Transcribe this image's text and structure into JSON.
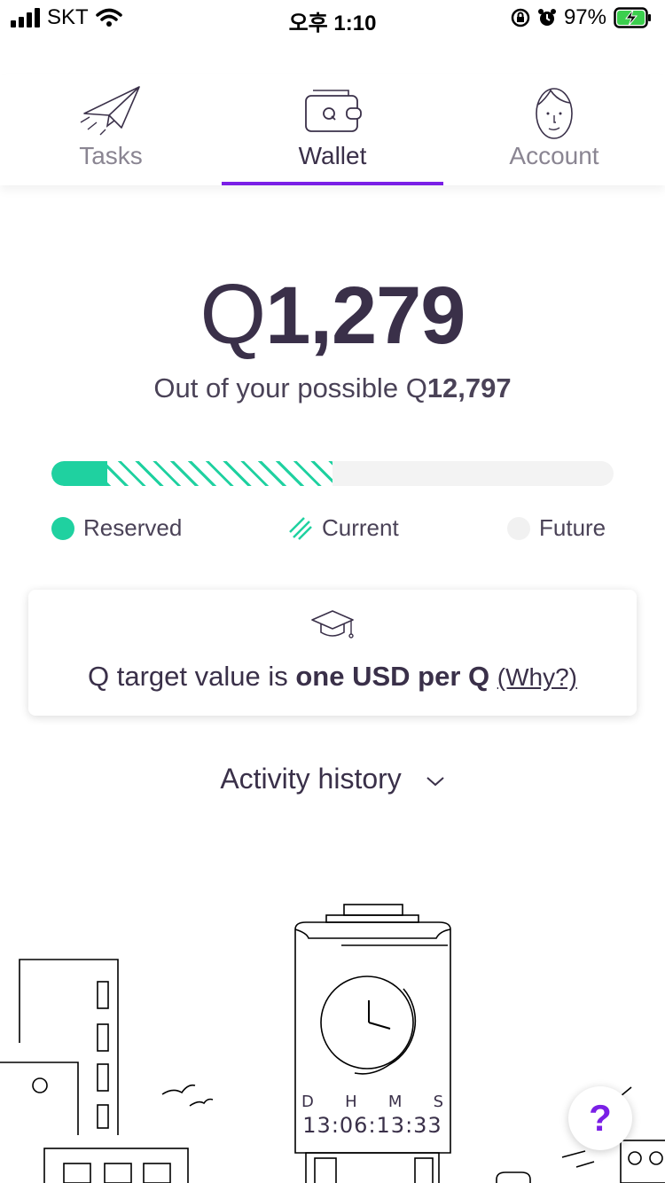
{
  "status": {
    "carrier": "SKT",
    "time": "오후 1:10",
    "battery": "97%"
  },
  "tabs": [
    {
      "label": "Tasks",
      "icon": "paper-plane-icon",
      "active": false
    },
    {
      "label": "Wallet",
      "icon": "wallet-icon",
      "active": true
    },
    {
      "label": "Account",
      "icon": "face-icon",
      "active": false
    }
  ],
  "balance": {
    "symbol": "Q",
    "amount": "1,279",
    "possible_prefix": "Out of your possible",
    "possible_symbol": "Q",
    "possible_amount": "12,797"
  },
  "progress": {
    "reserved_fraction": 0.1,
    "current_fraction": 0.5
  },
  "legend": {
    "reserved": "Reserved",
    "current": "Current",
    "future": "Future"
  },
  "colors": {
    "accent": "#7a1fe6",
    "reserved": "#1fd1a0",
    "text": "#3a3049"
  },
  "info_card": {
    "prefix": "Q target value is ",
    "bold": "one USD per Q",
    "link": "(Why?)",
    "icon": "graduation-cap-icon"
  },
  "activity": {
    "label": "Activity history"
  },
  "timer": {
    "labels": [
      "D",
      "H",
      "M",
      "S"
    ],
    "value": "13:06:13:33"
  },
  "help": {
    "label": "?"
  }
}
